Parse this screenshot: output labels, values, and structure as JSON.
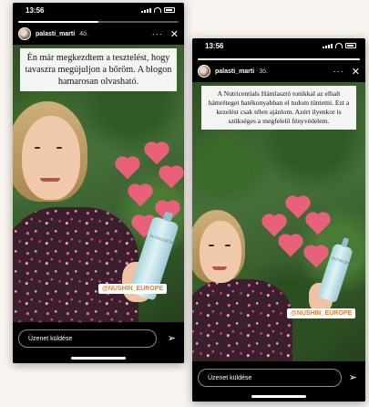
{
  "stories": [
    {
      "status_time": "13:56",
      "username": "palasti_marti",
      "time_ago": "4ó.",
      "more_icon": "more-icon",
      "close_icon": "close-icon",
      "caption": "Én már megkezdtem a tesztelést, hogy tavaszra megújuljon a bőröm. A blogon hamarosan olvasható.",
      "mention": "@NUSHIN_EUROPE",
      "reply_placeholder": "Üzenet küldése",
      "send_icon": "send-icon",
      "progress": 0.5
    },
    {
      "status_time": "13:56",
      "username": "palasti_marti",
      "time_ago": "3ó.",
      "more_icon": "more-icon",
      "close_icon": "close-icon",
      "caption": "A Nutricentials Hámlasztó tonikkal az elhalt hámréteget hatékonyabban el tudom tüntetni. Ezt a kezelést csak télen ajánlom. Azért ilyenkor is szükséges a megfelelő fényvédelem.",
      "mention": "@NUSHIN_EUROPE",
      "reply_placeholder": "Üzenet küldése",
      "send_icon": "send-icon",
      "progress": 1.0
    }
  ],
  "colors": {
    "heart": "#e8607a",
    "mention_text": "#e0832a"
  }
}
